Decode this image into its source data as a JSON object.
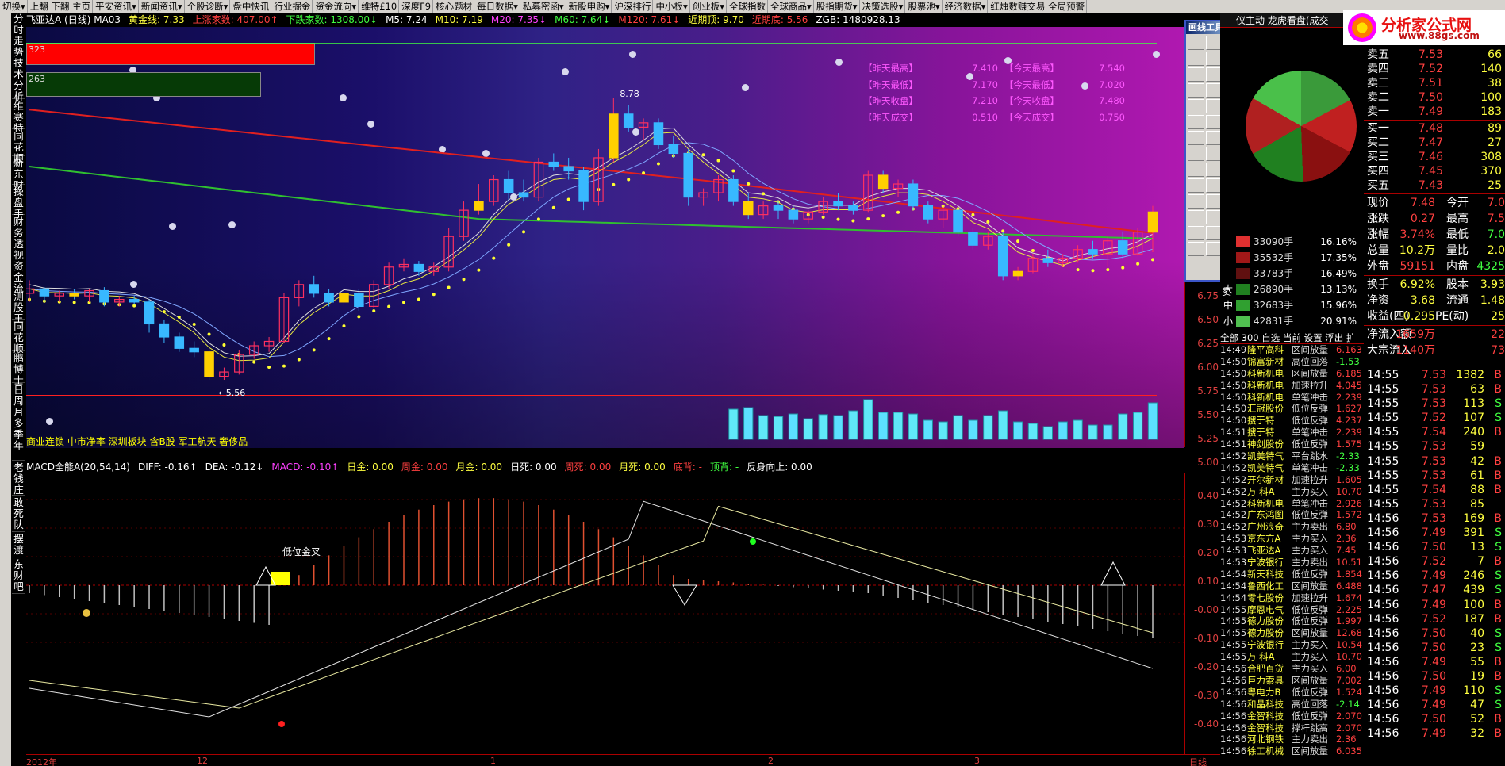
{
  "menu": [
    "切换▾",
    "上翻 下翻 主页",
    "平安资讯▾",
    "新闻资讯▾",
    "个股诊断▾",
    "盘中快讯",
    "行业掘金",
    "资金流向▾",
    "维特£10",
    "深度F9",
    "核心题材",
    "每日数据▾",
    "私募密函▾",
    "新股申购▾",
    "沪深排行",
    "中小板▾",
    "创业板▾",
    "全球指数",
    "全球商品▾",
    "股指期货▾",
    "决策选股▾",
    "股票池▾",
    "经济数据▾",
    "红烛数赚交易 全局预警"
  ],
  "left_tabs": [
    "分时走势",
    "技术分析",
    "维赛特",
    "同花顺",
    "新东财",
    "操盘手",
    "财务透视",
    "资金流",
    "测股王",
    "同花顺",
    "鹏博士",
    "日周月多季年",
    "老钱庄",
    "敢死队",
    "摆渡",
    "东财吧"
  ],
  "info_bar": [
    {
      "text": "飞亚达A (日线) MA03",
      "color": "#ffffff"
    },
    {
      "text": "黄金线: 7.33",
      "color": "#ffff40"
    },
    {
      "text": "上涨家数: 407.00↑",
      "color": "#ff4040"
    },
    {
      "text": "下跌家数: 1308.00↓",
      "color": "#40ff40"
    },
    {
      "text": "M5: 7.24",
      "color": "#ffffff"
    },
    {
      "text": "M10: 7.19",
      "color": "#ffff40"
    },
    {
      "text": "M20: 7.35↓",
      "color": "#ff40ff"
    },
    {
      "text": "M60: 7.64↓",
      "color": "#40ff40"
    },
    {
      "text": "M120: 7.61↓",
      "color": "#ff4040"
    },
    {
      "text": "近期顶: 9.70",
      "color": "#ffff40"
    },
    {
      "text": "近期底: 5.56",
      "color": "#ff4040"
    },
    {
      "text": "ZGB: 1480928.13",
      "color": "#ffffff"
    }
  ],
  "bars": {
    "up_count": "323",
    "down_count": "263"
  },
  "history": [
    {
      "l1": "【昨天最高】",
      "v1": "7.410",
      "l2": "【今天最高】",
      "v2": "7.540"
    },
    {
      "l1": "【昨天最低】",
      "v1": "7.170",
      "l2": "【今天最低】",
      "v2": "7.020"
    },
    {
      "l1": "【昨天收盘】",
      "v1": "7.210",
      "l2": "【今天收盘】",
      "v2": "7.480"
    },
    {
      "l1": "【昨天成交】",
      "v1": "0.510",
      "l2": "【今天成交】",
      "v2": "0.750"
    }
  ],
  "price_labels": {
    "high": "8.78",
    "low": "5.56"
  },
  "concept_tags": "商业连锁 中市净率 深圳板块 含B股 军工航天 奢侈品",
  "price_axis": [
    "6.75",
    "6.50",
    "6.25",
    "6.00",
    "5.75",
    "5.50",
    "5.25",
    "5.00"
  ],
  "macd_header": [
    {
      "text": "MACD全能A(20,54,14)",
      "color": "#ffffff"
    },
    {
      "text": "DIFF: -0.16↑",
      "color": "#ffffff"
    },
    {
      "text": "DEA: -0.12↓",
      "color": "#ffffff"
    },
    {
      "text": "MACD: -0.10↑",
      "color": "#ff40ff"
    },
    {
      "text": "日金: 0.00",
      "color": "#ffff40"
    },
    {
      "text": "周金: 0.00",
      "color": "#ff4040"
    },
    {
      "text": "月金: 0.00",
      "color": "#ffff40"
    },
    {
      "text": "日死: 0.00",
      "color": "#ffffff"
    },
    {
      "text": "周死: 0.00",
      "color": "#ff4040"
    },
    {
      "text": "月死: 0.00",
      "color": "#ffff40"
    },
    {
      "text": "底背: -",
      "color": "#ff4040"
    },
    {
      "text": "顶背: -",
      "color": "#40ff40"
    },
    {
      "text": "反身向上: 0.00",
      "color": "#ffffff"
    }
  ],
  "macd_label": "低位金叉",
  "macd_axis": [
    "0.40",
    "0.30",
    "0.20",
    "0.10",
    "-0.00",
    "-0.10",
    "-0.20",
    "-0.30",
    "-0.40"
  ],
  "time_axis": [
    "2012年",
    "12",
    "1",
    "2",
    "3",
    "日线"
  ],
  "drawing_tools": {
    "title": "画线工具",
    "close": "×"
  },
  "right_panel": {
    "top_tabs": "仪主动 龙虎看盘(成交",
    "logo_title": "分析家公式网",
    "logo_url": "www.88gs.com"
  },
  "flow_rows": [
    {
      "lbl": "",
      "color": "#e03030",
      "v": "33090手",
      "p": "16.16%"
    },
    {
      "lbl": "",
      "color": "#a01818",
      "v": "35532手",
      "p": "17.35%"
    },
    {
      "lbl": "",
      "color": "#601010",
      "v": "33783手",
      "p": "16.49%"
    },
    {
      "lbl": "大",
      "color": "#208020",
      "v": "26890手",
      "p": "13.13%"
    },
    {
      "lbl": "中",
      "color": "#30a030",
      "v": "32683手",
      "p": "15.96%"
    },
    {
      "lbl": "小",
      "color": "#50c050",
      "v": "42831手",
      "p": "20.91%"
    }
  ],
  "flow_side_label": "卖",
  "order_book": [
    {
      "n": "卖五",
      "p": "7.53",
      "v": "66"
    },
    {
      "n": "卖四",
      "p": "7.52",
      "v": "140"
    },
    {
      "n": "卖三",
      "p": "7.51",
      "v": "38"
    },
    {
      "n": "卖二",
      "p": "7.50",
      "v": "100"
    },
    {
      "n": "卖一",
      "p": "7.49",
      "v": "183"
    },
    {
      "n": "买一",
      "p": "7.48",
      "v": "89"
    },
    {
      "n": "买二",
      "p": "7.47",
      "v": "27"
    },
    {
      "n": "买三",
      "p": "7.46",
      "v": "308"
    },
    {
      "n": "买四",
      "p": "7.45",
      "v": "370"
    },
    {
      "n": "买五",
      "p": "7.43",
      "v": "25"
    }
  ],
  "stats": [
    {
      "a": "现价",
      "b": "7.48",
      "bc": "#ff4040",
      "c": "今开",
      "d": "7.0",
      "dc": "#ff4040"
    },
    {
      "a": "涨跌",
      "b": "0.27",
      "bc": "#ff4040",
      "c": "最高",
      "d": "7.5",
      "dc": "#ff4040"
    },
    {
      "a": "涨幅",
      "b": "3.74%",
      "bc": "#ff4040",
      "c": "最低",
      "d": "7.0",
      "dc": "#40ff40"
    },
    {
      "a": "总量",
      "b": "10.2万",
      "bc": "#ffff40",
      "c": "量比",
      "d": "2.0",
      "dc": "#ffff40"
    },
    {
      "a": "外盘",
      "b": "59151",
      "bc": "#ff4040",
      "c": "内盘",
      "d": "4325",
      "dc": "#40ff40"
    },
    {
      "a": "换手",
      "b": "6.92%",
      "bc": "#ffff40",
      "c": "股本",
      "d": "3.93",
      "dc": "#ffff40"
    },
    {
      "a": "净资",
      "b": "3.68",
      "bc": "#ffff40",
      "c": "流通",
      "d": "1.48",
      "dc": "#ffff40"
    },
    {
      "a": "收益(四)",
      "b": "0.295",
      "bc": "#ffff40",
      "c": "PE(动)",
      "d": "25",
      "dc": "#ffff40"
    },
    {
      "a": "净流入额",
      "b": "1659万",
      "bc": "#ff4040",
      "c": "",
      "d": "22",
      "dc": "#ff4040"
    },
    {
      "a": "大宗流入",
      "b": "1140万",
      "bc": "#ff4040",
      "c": "",
      "d": "73",
      "dc": "#ff4040"
    }
  ],
  "ticks": [
    {
      "t": "14:55",
      "p": "7.53",
      "v": "1382",
      "d": "B"
    },
    {
      "t": "14:55",
      "p": "7.53",
      "v": "63",
      "d": "B"
    },
    {
      "t": "14:55",
      "p": "7.53",
      "v": "113",
      "d": "S"
    },
    {
      "t": "14:55",
      "p": "7.52",
      "v": "107",
      "d": "S"
    },
    {
      "t": "14:55",
      "p": "7.54",
      "v": "240",
      "d": "B"
    },
    {
      "t": "14:55",
      "p": "7.53",
      "v": "59",
      "d": ""
    },
    {
      "t": "14:55",
      "p": "7.53",
      "v": "42",
      "d": "B"
    },
    {
      "t": "14:55",
      "p": "7.53",
      "v": "61",
      "d": "B"
    },
    {
      "t": "14:55",
      "p": "7.54",
      "v": "88",
      "d": "B"
    },
    {
      "t": "14:55",
      "p": "7.53",
      "v": "85",
      "d": ""
    },
    {
      "t": "14:56",
      "p": "7.53",
      "v": "169",
      "d": "B"
    },
    {
      "t": "14:56",
      "p": "7.49",
      "v": "391",
      "d": "S"
    },
    {
      "t": "14:56",
      "p": "7.50",
      "v": "13",
      "d": "S"
    },
    {
      "t": "14:56",
      "p": "7.52",
      "v": "7",
      "d": "B"
    },
    {
      "t": "14:56",
      "p": "7.49",
      "v": "246",
      "d": "S"
    },
    {
      "t": "14:56",
      "p": "7.47",
      "v": "439",
      "d": "S"
    },
    {
      "t": "14:56",
      "p": "7.49",
      "v": "100",
      "d": "B"
    },
    {
      "t": "14:56",
      "p": "7.52",
      "v": "187",
      "d": "B"
    },
    {
      "t": "14:56",
      "p": "7.50",
      "v": "40",
      "d": "S"
    },
    {
      "t": "14:56",
      "p": "7.50",
      "v": "23",
      "d": "S"
    },
    {
      "t": "14:56",
      "p": "7.49",
      "v": "55",
      "d": "B"
    },
    {
      "t": "14:56",
      "p": "7.50",
      "v": "19",
      "d": "B"
    },
    {
      "t": "14:56",
      "p": "7.49",
      "v": "110",
      "d": "S"
    },
    {
      "t": "14:56",
      "p": "7.49",
      "v": "47",
      "d": "S"
    },
    {
      "t": "14:56",
      "p": "7.50",
      "v": "52",
      "d": "B"
    },
    {
      "t": "14:56",
      "p": "7.49",
      "v": "32",
      "d": "B"
    }
  ],
  "list_header": "全部  300  自选 当前 设置 浮出 扩",
  "alerts": [
    {
      "t": "14:49",
      "nm": "隆平高科",
      "st": "区间放量",
      "v": "6.163"
    },
    {
      "t": "14:50",
      "nm": "锦富新材",
      "st": "高位回落",
      "v": "-1.53"
    },
    {
      "t": "14:50",
      "nm": "科新机电",
      "st": "区间放量",
      "v": "6.185"
    },
    {
      "t": "14:50",
      "nm": "科新机电",
      "st": "加速拉升",
      "v": "4.045"
    },
    {
      "t": "14:50",
      "nm": "科新机电",
      "st": "单笔冲击",
      "v": "2.239"
    },
    {
      "t": "14:50",
      "nm": "汇冠股份",
      "st": "低位反弹",
      "v": "1.627"
    },
    {
      "t": "14:50",
      "nm": "搜于特",
      "st": "低位反弹",
      "v": "4.237"
    },
    {
      "t": "14:51",
      "nm": "搜于特",
      "st": "单笔冲击",
      "v": "2.239"
    },
    {
      "t": "14:51",
      "nm": "神剑股份",
      "st": "低位反弹",
      "v": "1.575"
    },
    {
      "t": "14:52",
      "nm": "凯美特气",
      "st": "平台跳水",
      "v": "-2.33"
    },
    {
      "t": "14:52",
      "nm": "凯美特气",
      "st": "单笔冲击",
      "v": "-2.33"
    },
    {
      "t": "14:52",
      "nm": "开尔新材",
      "st": "加速拉升",
      "v": "1.605"
    },
    {
      "t": "14:52",
      "nm": "万 科A",
      "st": "主力买入",
      "v": "10.70"
    },
    {
      "t": "14:52",
      "nm": "科新机电",
      "st": "单笔冲击",
      "v": "2.926"
    },
    {
      "t": "14:52",
      "nm": "广东鸿图",
      "st": "低位反弹",
      "v": "1.572"
    },
    {
      "t": "14:52",
      "nm": "广州浪奇",
      "st": "主力卖出",
      "v": "6.80"
    },
    {
      "t": "14:53",
      "nm": "京东方A",
      "st": "主力买入",
      "v": "2.36"
    },
    {
      "t": "14:53",
      "nm": "飞亚达A",
      "st": "主力买入",
      "v": "7.45"
    },
    {
      "t": "14:53",
      "nm": "宁波银行",
      "st": "主力卖出",
      "v": "10.51"
    },
    {
      "t": "14:54",
      "nm": "新天科技",
      "st": "低位反弹",
      "v": "1.854"
    },
    {
      "t": "14:54",
      "nm": "鲁西化工",
      "st": "区间放量",
      "v": "6.488"
    },
    {
      "t": "14:54",
      "nm": "零七股份",
      "st": "加速拉升",
      "v": "1.674"
    },
    {
      "t": "14:55",
      "nm": "摩恩电气",
      "st": "低位反弹",
      "v": "2.225"
    },
    {
      "t": "14:55",
      "nm": "德力股份",
      "st": "低位反弹",
      "v": "1.997"
    },
    {
      "t": "14:55",
      "nm": "德力股份",
      "st": "区间放量",
      "v": "12.68"
    },
    {
      "t": "14:55",
      "nm": "宁波银行",
      "st": "主力买入",
      "v": "10.54"
    },
    {
      "t": "14:55",
      "nm": "万 科A",
      "st": "主力买入",
      "v": "10.70"
    },
    {
      "t": "14:56",
      "nm": "合肥百货",
      "st": "主力买入",
      "v": "6.00"
    },
    {
      "t": "14:56",
      "nm": "巨力索具",
      "st": "区间放量",
      "v": "7.002"
    },
    {
      "t": "14:56",
      "nm": "粤电力B",
      "st": "低位反弹",
      "v": "1.524"
    },
    {
      "t": "14:56",
      "nm": "和晶科技",
      "st": "高位回落",
      "v": "-2.14"
    },
    {
      "t": "14:56",
      "nm": "金智科技",
      "st": "低位反弹",
      "v": "2.070"
    },
    {
      "t": "14:56",
      "nm": "金智科技",
      "st": "撑杆跳高",
      "v": "2.070"
    },
    {
      "t": "14:56",
      "nm": "河北钢铁",
      "st": "主力卖出",
      "v": "2.36"
    },
    {
      "t": "14:56",
      "nm": "徐工机械",
      "st": "区间放量",
      "v": "6.035"
    }
  ],
  "chart_data": {
    "type": "candlestick",
    "title": "飞亚达A (日线)",
    "ylim": [
      5.0,
      8.78
    ],
    "candles": [
      [
        6.55,
        6.7,
        6.45,
        6.6
      ],
      [
        6.6,
        6.62,
        6.45,
        6.52
      ],
      [
        6.52,
        6.58,
        6.45,
        6.55
      ],
      [
        6.55,
        6.6,
        6.48,
        6.52
      ],
      [
        6.52,
        6.6,
        6.45,
        6.58
      ],
      [
        6.58,
        6.62,
        6.4,
        6.45
      ],
      [
        6.45,
        6.52,
        6.4,
        6.48
      ],
      [
        6.48,
        6.52,
        6.42,
        6.45
      ],
      [
        6.45,
        6.48,
        6.1,
        6.2
      ],
      [
        6.2,
        6.25,
        5.98,
        6.05
      ],
      [
        6.05,
        6.1,
        5.88,
        5.92
      ],
      [
        5.92,
        6.0,
        5.82,
        5.88
      ],
      [
        5.88,
        5.9,
        5.56,
        5.6
      ],
      [
        5.6,
        5.7,
        5.56,
        5.65
      ],
      [
        5.65,
        5.9,
        5.62,
        5.85
      ],
      [
        5.85,
        6.0,
        5.8,
        5.95
      ],
      [
        5.95,
        6.05,
        5.88,
        6.0
      ],
      [
        6.0,
        6.55,
        5.98,
        6.5
      ],
      [
        6.5,
        6.7,
        6.4,
        6.65
      ],
      [
        6.65,
        6.75,
        6.5,
        6.55
      ],
      [
        6.55,
        6.6,
        6.4,
        6.45
      ],
      [
        6.45,
        6.6,
        6.4,
        6.55
      ],
      [
        6.55,
        6.6,
        6.35,
        6.4
      ],
      [
        6.4,
        6.7,
        6.38,
        6.65
      ],
      [
        6.65,
        6.9,
        6.6,
        6.85
      ],
      [
        6.85,
        6.95,
        6.8,
        6.88
      ],
      [
        6.88,
        6.92,
        6.75,
        6.8
      ],
      [
        6.8,
        6.9,
        6.75,
        6.85
      ],
      [
        6.85,
        7.3,
        6.8,
        7.2
      ],
      [
        7.2,
        7.6,
        7.15,
        7.5
      ],
      [
        7.5,
        7.8,
        7.45,
        7.6
      ],
      [
        7.6,
        7.9,
        7.55,
        7.85
      ],
      [
        7.85,
        7.95,
        7.6,
        7.7
      ],
      [
        7.7,
        7.85,
        7.6,
        7.65
      ],
      [
        7.65,
        8.1,
        7.6,
        8.05
      ],
      [
        8.05,
        8.15,
        7.95,
        8.0
      ],
      [
        8.0,
        8.1,
        7.85,
        7.95
      ],
      [
        7.95,
        8.0,
        7.5,
        7.6
      ],
      [
        7.6,
        8.2,
        7.55,
        8.1
      ],
      [
        8.1,
        8.78,
        8.05,
        8.6
      ],
      [
        8.6,
        8.7,
        8.4,
        8.45
      ],
      [
        8.45,
        8.55,
        8.3,
        8.5
      ],
      [
        8.5,
        8.55,
        8.2,
        8.25
      ],
      [
        8.25,
        8.35,
        8.1,
        8.15
      ],
      [
        8.15,
        8.2,
        7.55,
        7.65
      ],
      [
        7.65,
        7.75,
        7.55,
        7.7
      ],
      [
        7.7,
        7.9,
        7.6,
        7.85
      ],
      [
        7.85,
        7.9,
        7.55,
        7.6
      ],
      [
        7.6,
        7.7,
        7.4,
        7.45
      ],
      [
        7.45,
        7.6,
        7.4,
        7.55
      ],
      [
        7.55,
        7.6,
        7.4,
        7.5
      ],
      [
        7.5,
        7.55,
        7.35,
        7.4
      ],
      [
        7.4,
        7.5,
        7.35,
        7.48
      ],
      [
        7.48,
        7.65,
        7.45,
        7.6
      ],
      [
        7.6,
        7.7,
        7.5,
        7.55
      ],
      [
        7.55,
        7.6,
        7.45,
        7.5
      ],
      [
        7.5,
        7.95,
        7.48,
        7.9
      ],
      [
        7.9,
        7.95,
        7.7,
        7.75
      ],
      [
        7.75,
        7.85,
        7.65,
        7.8
      ],
      [
        7.8,
        7.85,
        7.5,
        7.55
      ],
      [
        7.55,
        7.6,
        7.35,
        7.4
      ],
      [
        7.4,
        7.55,
        7.3,
        7.5
      ],
      [
        7.5,
        7.55,
        7.2,
        7.25
      ],
      [
        7.25,
        7.3,
        7.05,
        7.1
      ],
      [
        7.1,
        7.25,
        7.05,
        7.2
      ],
      [
        7.2,
        7.25,
        6.7,
        6.75
      ],
      [
        6.75,
        6.85,
        6.7,
        6.8
      ],
      [
        6.8,
        7.0,
        6.78,
        6.95
      ],
      [
        6.95,
        7.05,
        6.85,
        6.9
      ],
      [
        6.9,
        7.0,
        6.85,
        6.95
      ],
      [
        6.95,
        7.1,
        6.9,
        7.05
      ],
      [
        7.05,
        7.15,
        6.95,
        7.0
      ],
      [
        7.0,
        7.2,
        6.85,
        7.15
      ],
      [
        7.15,
        7.25,
        6.95,
        7.0
      ],
      [
        7.0,
        7.3,
        6.98,
        7.25
      ],
      [
        7.25,
        7.55,
        7.02,
        7.48
      ]
    ],
    "volume": [
      0,
      0,
      0,
      0,
      0,
      0,
      0,
      0,
      0,
      0,
      0,
      0,
      0,
      0,
      0,
      0,
      0,
      0,
      0,
      0,
      0,
      0,
      0,
      0,
      0,
      0,
      0,
      0,
      0,
      0,
      0,
      0,
      0,
      0,
      0,
      0,
      0,
      0,
      0,
      0,
      0,
      0,
      0,
      0,
      0,
      0,
      0,
      0.95,
      1.0,
      0.75,
      0.72,
      0.8,
      0.65,
      0.78,
      0.75,
      0.9,
      1.25,
      0.85,
      0.85,
      0.8,
      0.6,
      0.55,
      0.75,
      0.6,
      0.75,
      0.9,
      0.55,
      0.5,
      0.4,
      0.55,
      0.6,
      0.45,
      0.45,
      0.8,
      0.85,
      1.15
    ]
  }
}
